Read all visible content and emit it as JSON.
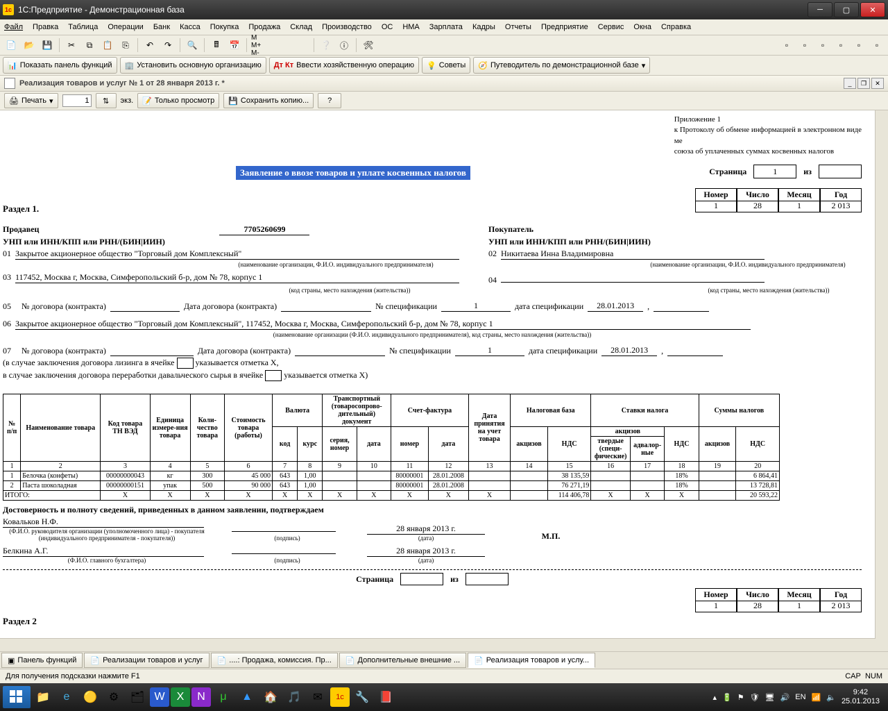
{
  "app_title": "1С:Предприятие - Демонстрационная база",
  "menu": [
    "Файл",
    "Правка",
    "Таблица",
    "Операции",
    "Банк",
    "Касса",
    "Покупка",
    "Продажа",
    "Склад",
    "Производство",
    "ОС",
    "НМА",
    "Зарплата",
    "Кадры",
    "Отчеты",
    "Предприятие",
    "Сервис",
    "Окна",
    "Справка"
  ],
  "tb2": {
    "show_panel": "Показать панель функций",
    "set_org": "Установить основную организацию",
    "enter_op": "Ввести хозяйственную операцию",
    "tips": "Советы",
    "guide": "Путеводитель по демонстрационной базе"
  },
  "doc_tab_title": "Реализация товаров и услуг № 1 от 28 января 2013 г. *",
  "print": "Печать",
  "copies": "1",
  "copies_label": "экз.",
  "view_only": "Только просмотр",
  "save_copy": "Сохранить копию...",
  "header": {
    "l1": "Приложение 1",
    "l2": "к Протоколу об обмене информацией в электронном виде",
    "l3": "ме",
    "l4": "союза об уплаченных суммах косвенных налогов"
  },
  "title": "Заявление о ввозе товаров и уплате косвенных налогов",
  "page_label": "Страница",
  "page_num": "1",
  "page_of": "из",
  "numhdr": {
    "n": "Номер",
    "d": "Число",
    "m": "Месяц",
    "y": "Год"
  },
  "numval": {
    "n": "1",
    "d": "28",
    "m": "1",
    "y": "2 013"
  },
  "section1": "Раздел 1.",
  "seller": "Продавец",
  "seller_code": "7705260699",
  "buyer": "Покупатель",
  "id_line": "УНП или ИНН/КПП или РНН/(БИН|ИИН)",
  "f01": "01",
  "f01v": "Закрытое акционерное общество \"Торговый дом Комплексный\"",
  "f02": "02",
  "f02v": "Никитаева Инна Владимировна",
  "hint_org": "(наименование организации, Ф.И.О. индивидуального предпринимателя)",
  "f03": "03",
  "f03v": "117452, Москва г, Москва, Симферопольский б-р, дом № 78, корпус 1",
  "f04": "04",
  "hint_addr": "(код страны, место нахождения (жительства))",
  "f05": "05",
  "contract_no": "№ договора (контракта)",
  "contract_date": "Дата договора (контракта)",
  "spec_no": "№ спецификации",
  "spec_no_v": "1",
  "spec_date": "дата спецификации",
  "spec_date_v": "28.01.2013",
  "f06": "06",
  "f06v": "Закрытое акционерное общество \"Торговый дом Комплексный\", 117452, Москва г, Москва, Симферопольский б-р, дом № 78, корпус 1",
  "hint06": "(наименование организации (Ф.И.О. индивидуального предпринимателя), код страны, место нахождения (жительства))",
  "f07": "07",
  "leasing": "(в случае заключения договора лизинга в ячейке",
  "leasing2": "указывается отметка Х,",
  "daval": "в случае заключения договора переработки давальческого сырья в ячейке",
  "daval2": "указывается отметка Х)",
  "thead": {
    "c1": "№ п/п",
    "c2": "Наименование товара",
    "c3": "Код товара ТН ВЭД",
    "c4": "Единица измере-ния товара",
    "c5": "Коли-чество товара",
    "c6": "Стоимость товара (работы)",
    "c7": "Валюта",
    "c7a": "код",
    "c7b": "курс",
    "c8": "Транспортный (товаросопрово-дительный) документ",
    "c8a": "серия, номер",
    "c8b": "дата",
    "c9": "Счет-фактура",
    "c9a": "номер",
    "c9b": "дата",
    "c10": "Дата принятия на учет товара",
    "c11": "Налоговая база",
    "c11a": "акцизов",
    "c11b": "НДС",
    "c12": "Ставки налога",
    "c12a": "акцизов",
    "c12aa": "твердые (специ-фические)",
    "c12ab": "адвалор-ные",
    "c12b": "НДС",
    "c13": "Суммы налогов",
    "c13a": "акцизов",
    "c13b": "НДС"
  },
  "colnums": [
    "1",
    "2",
    "3",
    "4",
    "5",
    "6",
    "7",
    "8",
    "9",
    "10",
    "11",
    "12",
    "13",
    "14",
    "15",
    "16",
    "17",
    "18",
    "19",
    "20"
  ],
  "rows": [
    {
      "n": "1",
      "name": "Белочка (конфеты)",
      "code": "00000000043",
      "unit": "кг",
      "qty": "300",
      "cost": "45 000",
      "ccode": "643",
      "rate": "1,00",
      "tser": "",
      "tdate": "",
      "inum": "80000001",
      "idate": "28.01.2008",
      "acc": "",
      "baseA": "",
      "baseN": "38 135,59",
      "rA1": "",
      "rA2": "",
      "rN": "18%",
      "sA": "",
      "sN": "6 864,41"
    },
    {
      "n": "2",
      "name": "Паста шоколадная",
      "code": "00000000151",
      "unit": "упак",
      "qty": "500",
      "cost": "90 000",
      "ccode": "643",
      "rate": "1,00",
      "tser": "",
      "tdate": "",
      "inum": "80000001",
      "idate": "28.01.2008",
      "acc": "",
      "baseA": "",
      "baseN": "76 271,19",
      "rA1": "",
      "rA2": "",
      "rN": "18%",
      "sA": "",
      "sN": "13 728,81"
    }
  ],
  "total": "ИТОГО:",
  "X": "Х",
  "total_baseN": "114 406,78",
  "total_sN": "20 593,22",
  "confirm": "Достоверность и полноту сведений, приведенных в данном заявлении, подтверждаем",
  "sign1": "Ковальков Н.Ф.",
  "sign1_hint": "(Ф.И.О. руководителя организации (уполномоченного лица) - покупателя (индивидуального предпринимателя - покупателя))",
  "sig": "(подпись)",
  "sign_date": "28 января 2013 г.",
  "date_hint": "(дата)",
  "mp": "М.П.",
  "sign2": "Белкина А.Г.",
  "sign2_hint": "(Ф.И.О. главного бухгалтера)",
  "section2": "Раздел 2",
  "btabs": [
    "Панель функций",
    "Реализации товаров и услуг",
    "....: Продажа, комиссия. Пр...",
    "Дополнительные внешние ...",
    "Реализация товаров и услу..."
  ],
  "status": "Для получения подсказки нажмите F1",
  "cap": "CAP",
  "num": "NUM",
  "lang": "EN",
  "time": "9:42",
  "date": "25.01.2013"
}
